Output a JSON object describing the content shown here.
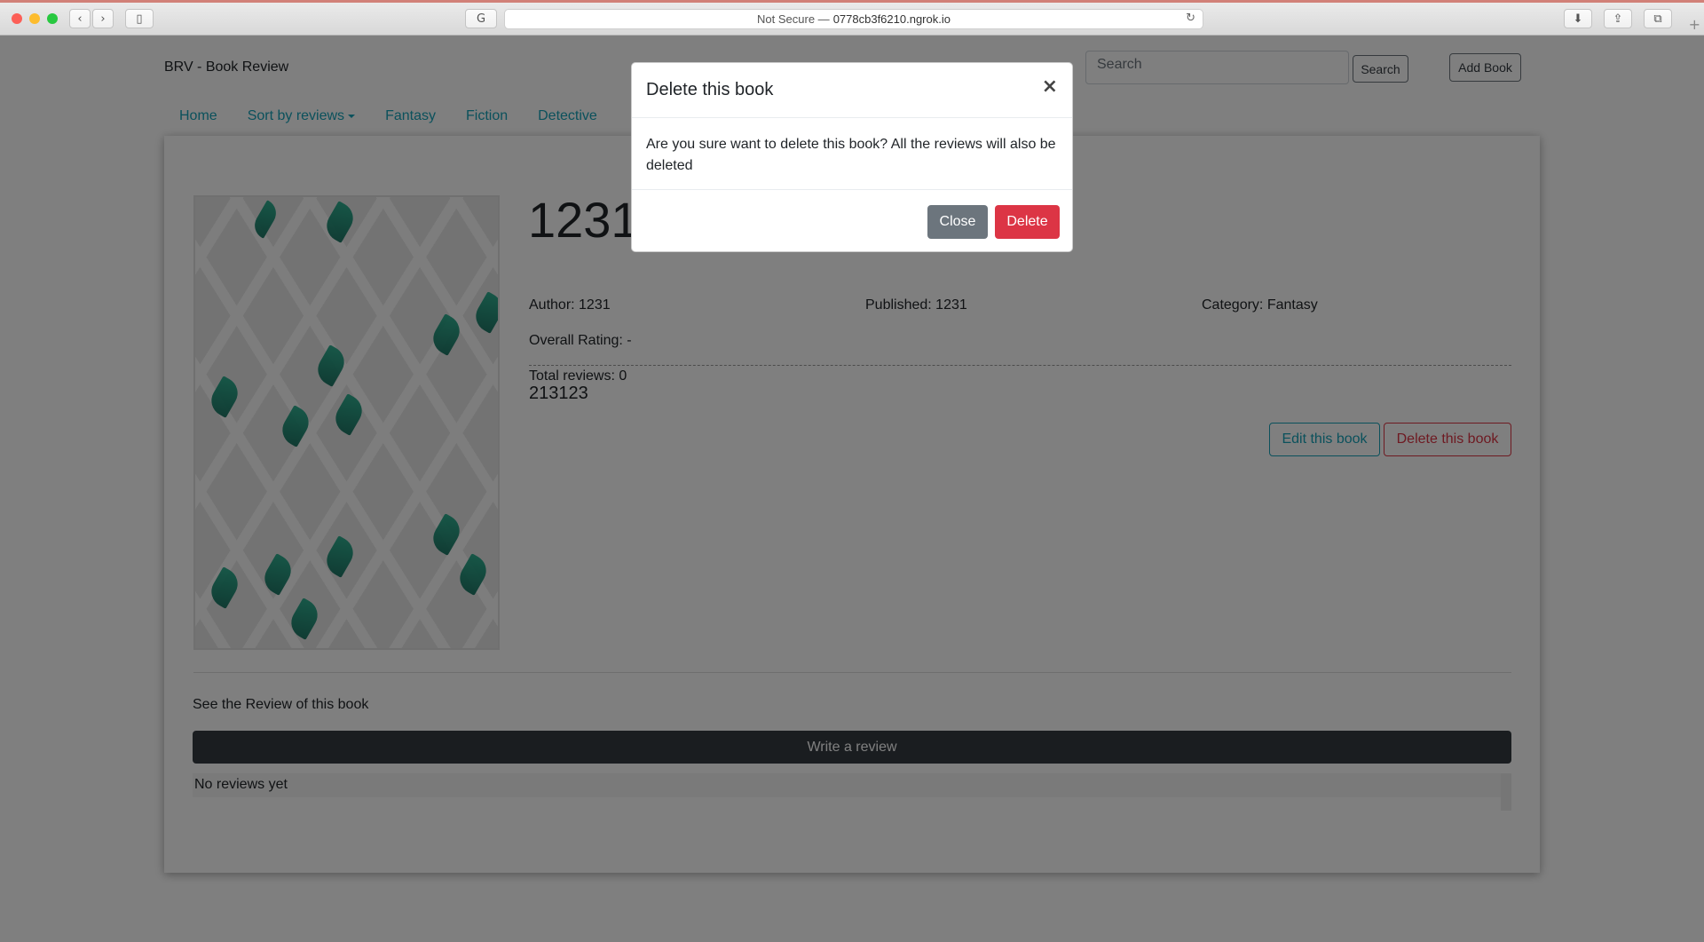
{
  "browser": {
    "security_label": "Not Secure —",
    "url": "0778cb3f6210.ngrok.io"
  },
  "navbar": {
    "brand": "BRV - Book Review",
    "search_placeholder": "Search",
    "search_button": "Search",
    "add_book_button": "Add Book",
    "links": [
      "Home",
      "Sort by reviews",
      "Fantasy",
      "Fiction",
      "Detective"
    ]
  },
  "book": {
    "title": "1231",
    "author": "Author: 1231",
    "published": "Published: 1231",
    "category": "Category: Fantasy",
    "rating": "Overall Rating: -",
    "total_reviews": "Total reviews: 0",
    "description": "213123",
    "edit_button": "Edit this book",
    "delete_button": "Delete this book"
  },
  "reviews": {
    "heading": "See the Review of this book",
    "write_button": "Write a review",
    "empty_text": "No reviews yet"
  },
  "modal": {
    "title": "Delete this book",
    "close_symbol": "×",
    "body": "Are you sure want to delete this book? All the reviews will also be deleted",
    "close_button": "Close",
    "delete_button": "Delete"
  },
  "colors": {
    "info": "#17a2b8",
    "danger": "#dc3545",
    "secondary": "#6c757d",
    "dark": "#343a40"
  }
}
